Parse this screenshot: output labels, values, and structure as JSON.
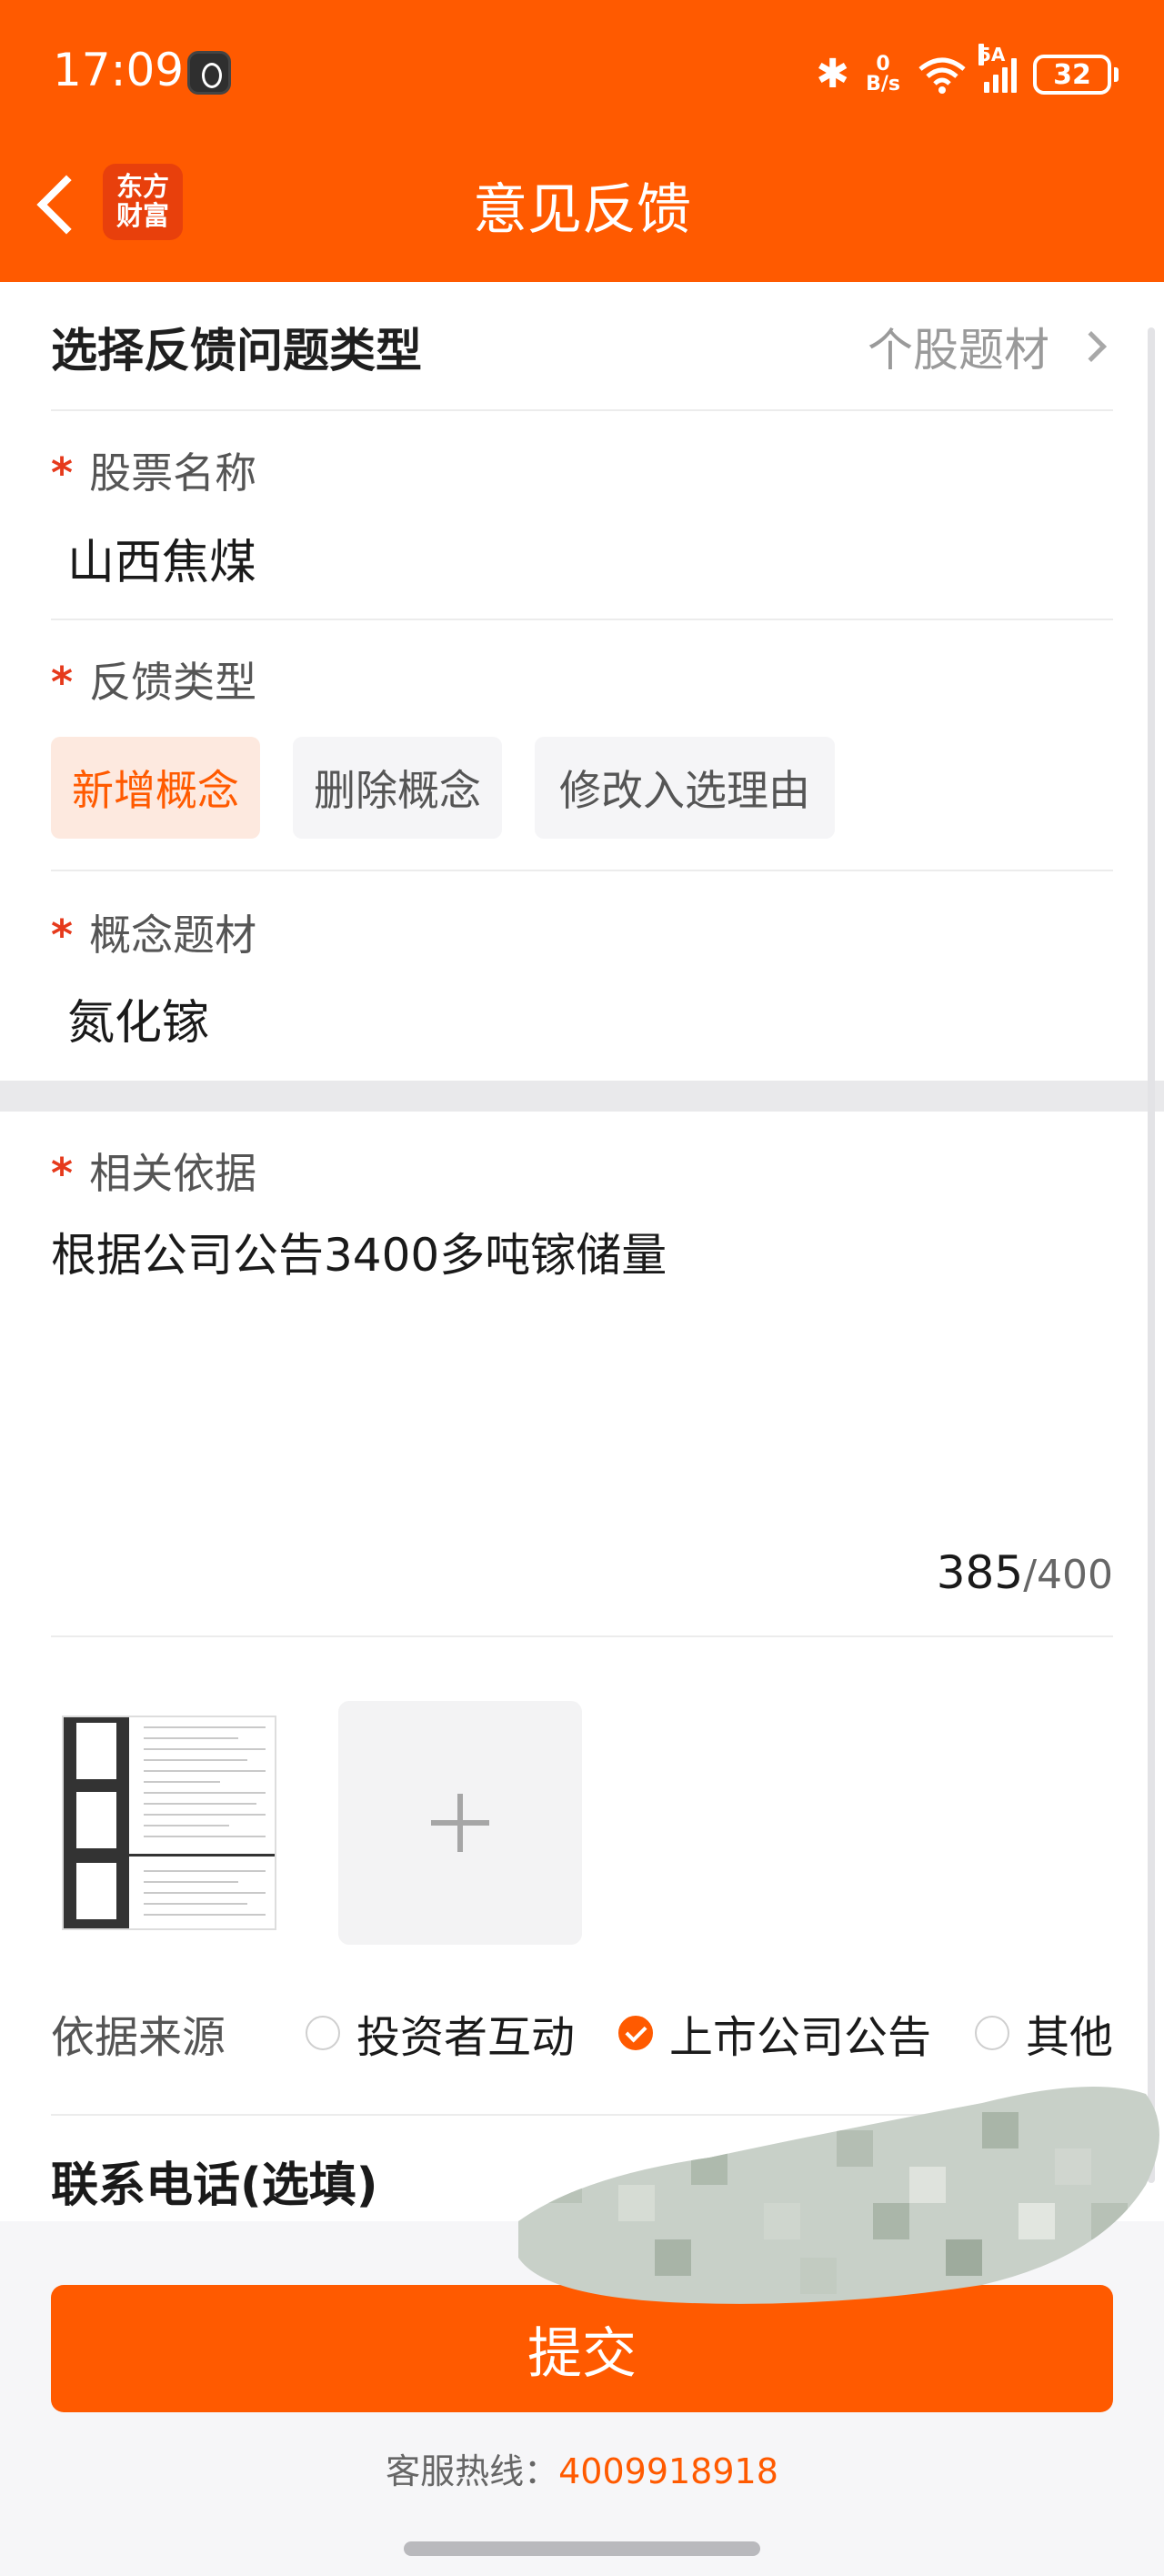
{
  "status_bar": {
    "time": "17:09",
    "net_speed_value": "0",
    "net_speed_unit": "B/s",
    "signal_label": "5A",
    "battery": "32"
  },
  "header": {
    "logo_line1": "东方",
    "logo_line2": "财富",
    "title": "意见反馈"
  },
  "feedback_type": {
    "label": "选择反馈问题类型",
    "value": "个股题材"
  },
  "stock": {
    "label": "股票名称",
    "value": "山西焦煤"
  },
  "kind": {
    "label": "反馈类型",
    "options": [
      "新增概念",
      "删除概念",
      "修改入选理由"
    ],
    "selected": "新增概念"
  },
  "concept": {
    "label": "概念题材",
    "value": "氮化镓"
  },
  "basis": {
    "label": "相关依据",
    "value": "根据公司公告3400多吨镓储量",
    "count": "385",
    "max": "/400"
  },
  "source": {
    "label": "依据来源",
    "options": [
      "投资者互动",
      "上市公司公告",
      "其他"
    ],
    "selected": "上市公司公告"
  },
  "phone": {
    "label": "联系电话(选填)"
  },
  "submit_label": "提交",
  "hotline": {
    "label": "客服热线：",
    "number": "4009918918"
  },
  "colors": {
    "brand": "#ff5a00",
    "required_star": "#e63a1c",
    "chip_active_bg": "#fde9df"
  },
  "icons": [
    "back-arrow-icon",
    "bluetooth-icon",
    "wifi-icon",
    "signal-icon",
    "battery-icon",
    "chevron-right-icon",
    "plus-icon",
    "check-icon"
  ],
  "star": "*"
}
